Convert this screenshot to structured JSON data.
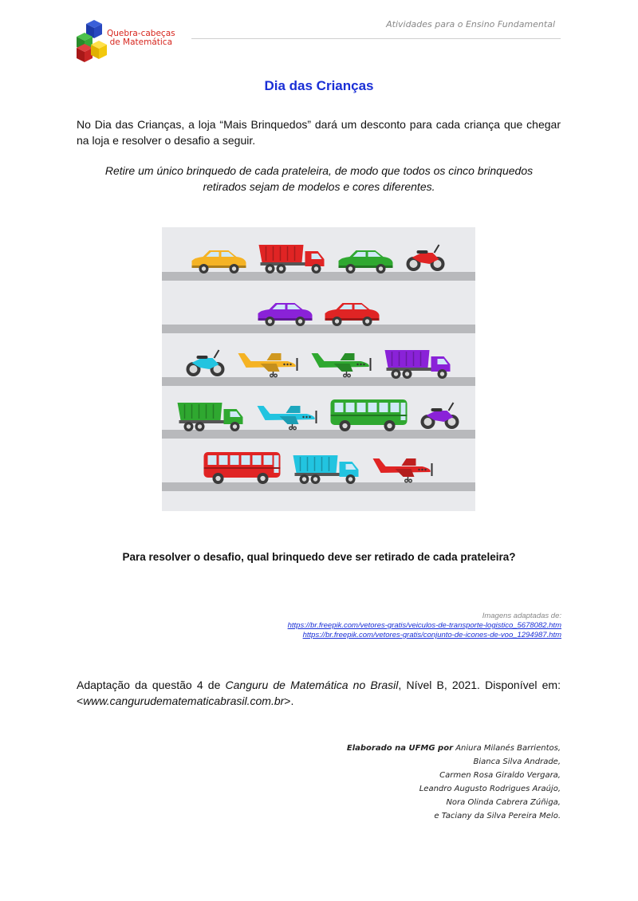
{
  "header": {
    "tagline": "Atividades para o Ensino Fundamental",
    "logo_line1": "Quebra-cabeças",
    "logo_line2": "de Matemática"
  },
  "title": "Dia das Crianças",
  "intro": "No Dia das Crianças, a loja “Mais Brinquedos” dará um desconto para cada criança que chegar na loja e resolver o desafio a seguir.",
  "challenge": "Retire um único brinquedo de cada prateleira, de modo que todos os cinco brinquedos retirados sejam de modelos e cores diferentes.",
  "shelves": [
    {
      "toys": [
        {
          "model": "car",
          "color": "#f5b324"
        },
        {
          "model": "truck",
          "color": "#e02424"
        },
        {
          "model": "car",
          "color": "#2fa830"
        },
        {
          "model": "motorcycle",
          "color": "#e02424"
        }
      ]
    },
    {
      "toys": [
        {
          "model": "car",
          "color": "#8a22d8"
        },
        {
          "model": "car",
          "color": "#e02424"
        }
      ]
    },
    {
      "toys": [
        {
          "model": "motorcycle",
          "color": "#22c4e0"
        },
        {
          "model": "plane",
          "color": "#f5b324"
        },
        {
          "model": "plane",
          "color": "#2fa830"
        },
        {
          "model": "truck",
          "color": "#8a22d8"
        }
      ]
    },
    {
      "toys": [
        {
          "model": "truck",
          "color": "#2fa830"
        },
        {
          "model": "plane",
          "color": "#22c4e0"
        },
        {
          "model": "bus",
          "color": "#2fa830"
        },
        {
          "model": "motorcycle",
          "color": "#8a22d8"
        }
      ]
    },
    {
      "toys": [
        {
          "model": "bus",
          "color": "#e02424"
        },
        {
          "model": "truck",
          "color": "#22c4e0"
        },
        {
          "model": "plane",
          "color": "#e02424"
        }
      ]
    }
  ],
  "question": "Para resolver o desafio, qual brinquedo deve ser retirado de cada prateleira?",
  "credits": {
    "label": "Imagens adaptadas de:",
    "link1": "https://br.freepik.com/vetores-gratis/veiculos-de-transporte-logistico_5678082.htm",
    "link2": "https://br.freepik.com/vetores-gratis/conjunto-de-icones-de-voo_1294987.htm"
  },
  "adaptation": {
    "pre": "Adaptação da questão 4 de ",
    "source": "Canguru de Matemática no Brasil",
    "mid": ", Nível B, 2021. Disponível em: <",
    "url": "www.cangurudematematicabrasil.com.br",
    "post": ">."
  },
  "authors": {
    "label": "Elaborado na UFMG por",
    "names": [
      "Aniura Milanés Barrientos,",
      "Bianca Silva Andrade,",
      "Carmen Rosa Giraldo Vergara,",
      "Leandro Augusto Rodrigues Araújo,",
      "Nora Olinda Cabrera Zúñiga,",
      "e Taciany da Silva Pereira Melo."
    ]
  }
}
